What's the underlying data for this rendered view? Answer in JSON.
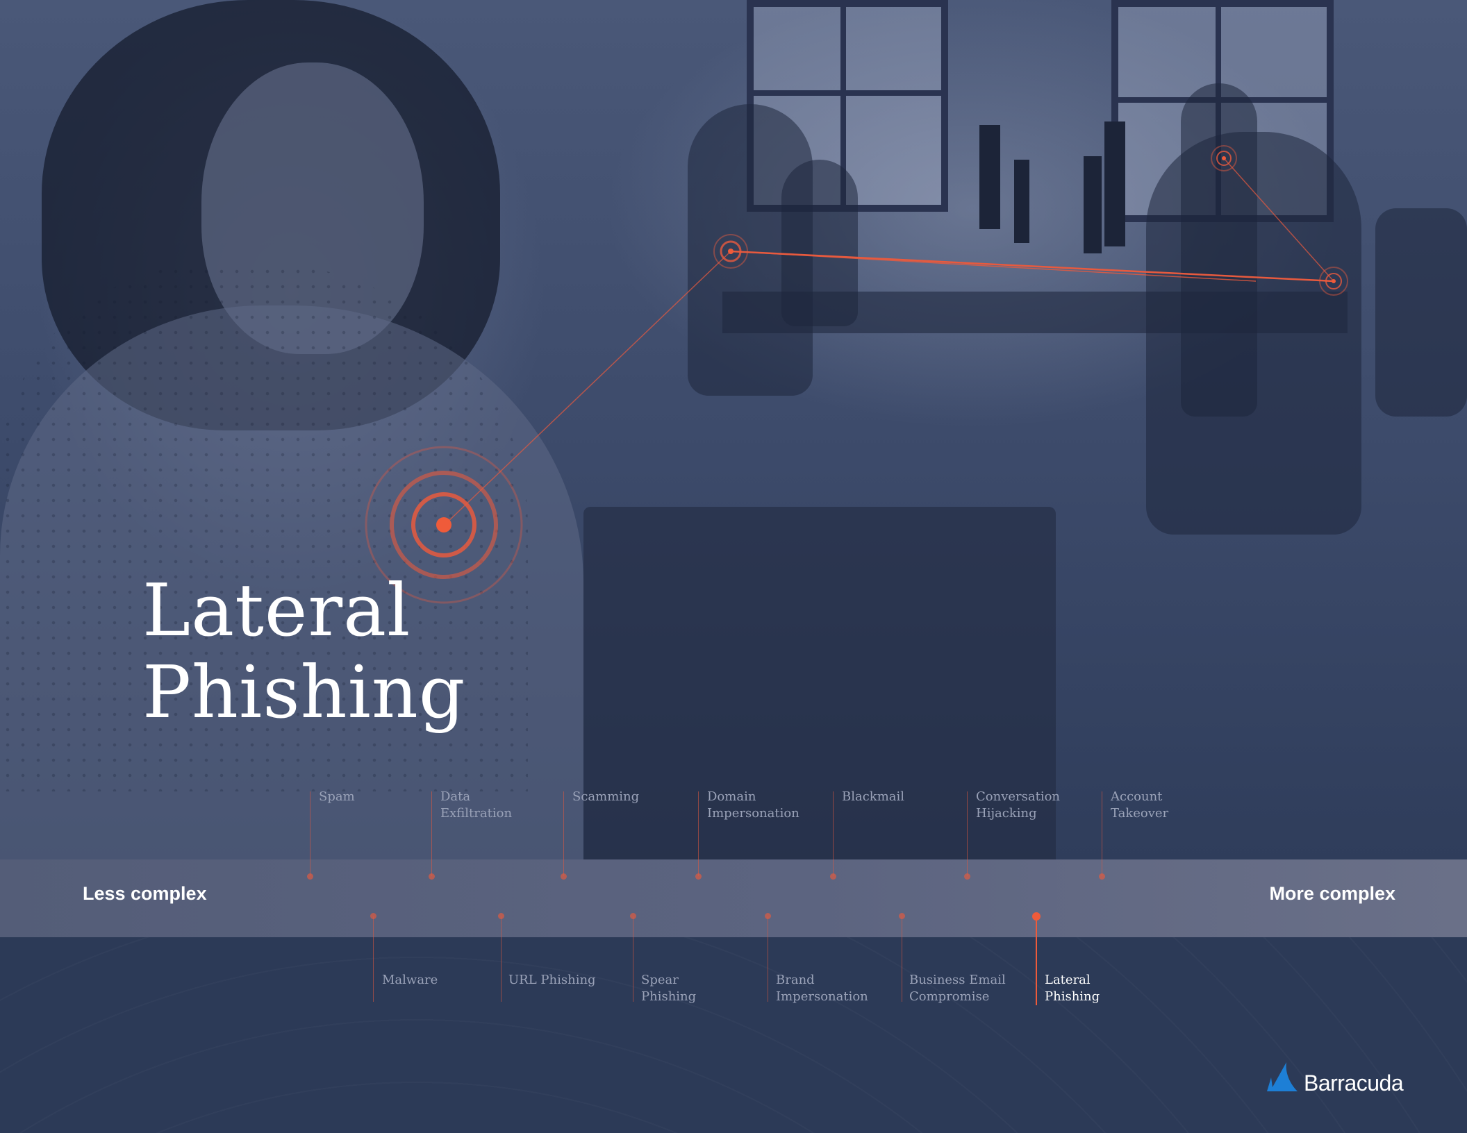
{
  "title": {
    "line1": "Lateral",
    "line2": "Phishing"
  },
  "scale": {
    "left_label": "Less complex",
    "right_label": "More complex"
  },
  "top_labels": [
    {
      "text": "Spam"
    },
    {
      "text": "Data\nExfiltration"
    },
    {
      "text": "Scamming"
    },
    {
      "text": "Domain\nImpersonation"
    },
    {
      "text": "Blackmail"
    },
    {
      "text": "Conversation\nHijacking"
    },
    {
      "text": "Account\nTakeover"
    }
  ],
  "bottom_labels": [
    {
      "text": "Malware"
    },
    {
      "text": "URL Phishing"
    },
    {
      "text": "Spear\nPhishing"
    },
    {
      "text": "Brand\nImpersonation"
    },
    {
      "text": "Business Email\nCompromise"
    },
    {
      "text": "Lateral\nPhishing",
      "active": true
    }
  ],
  "brand": {
    "name": "Barracuda"
  },
  "colors": {
    "accent": "#ef5b3a",
    "background": "#2c3a57",
    "band": "#5c6480",
    "logo_blue": "#1d7fd6"
  }
}
